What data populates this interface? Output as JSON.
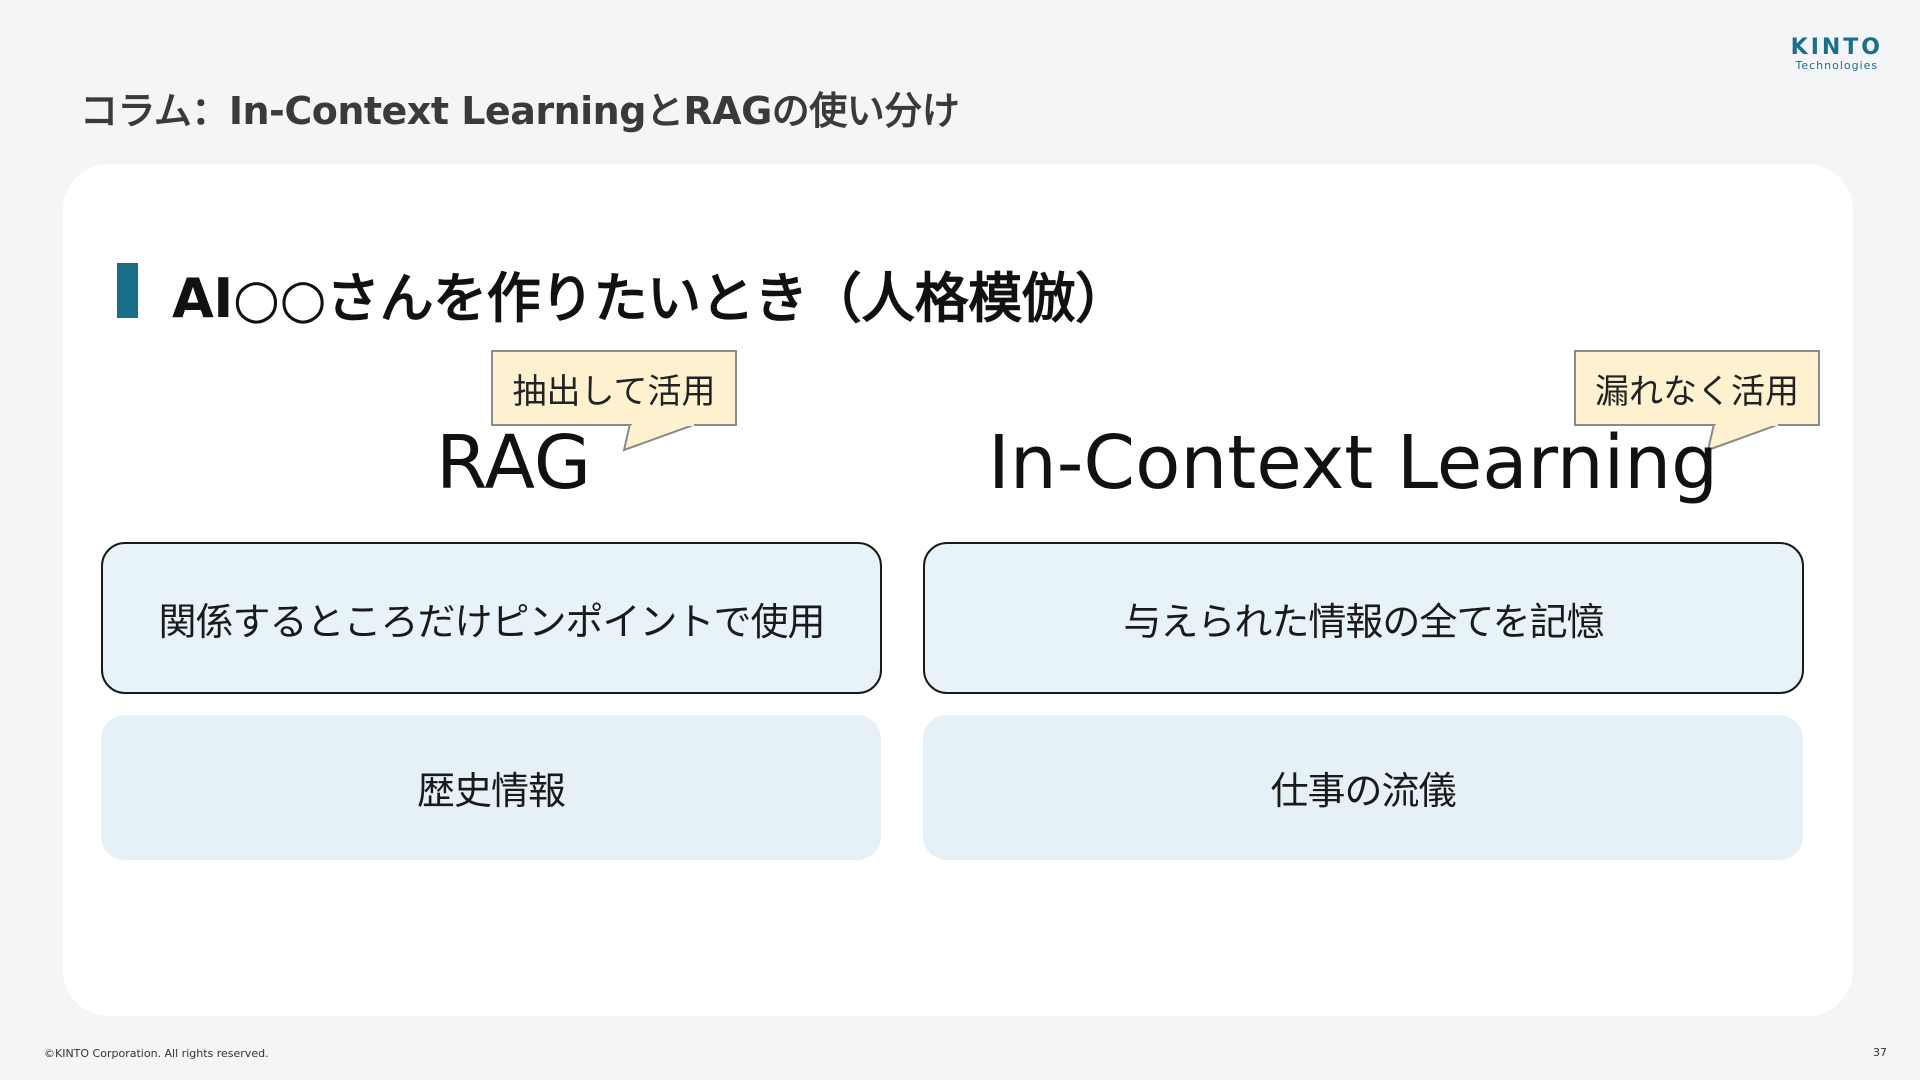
{
  "header": {
    "title": "コラム：In-Context LearningとRAGの使い分け",
    "logo_main": "KINTO",
    "logo_sub": "Technologies"
  },
  "section": {
    "heading": "AI○○さんを作りたいとき（人格模倣）"
  },
  "columns": [
    {
      "title": "RAG",
      "callout": "抽出して活用",
      "description": "関係するところだけピンポイントで使用",
      "example": "歴史情報"
    },
    {
      "title": "In-Context Learning",
      "callout": "漏れなく活用",
      "description": "与えられた情報の全てを記憶",
      "example": "仕事の流儀"
    }
  ],
  "footer": {
    "copyright": "©KINTO Corporation. All rights reserved.",
    "page_number": "37"
  },
  "colors": {
    "accent": "#176f8a",
    "callout_bg": "#fdf1d0",
    "box_bg": "#e8f2f9",
    "page_bg": "#f3f5f7"
  }
}
